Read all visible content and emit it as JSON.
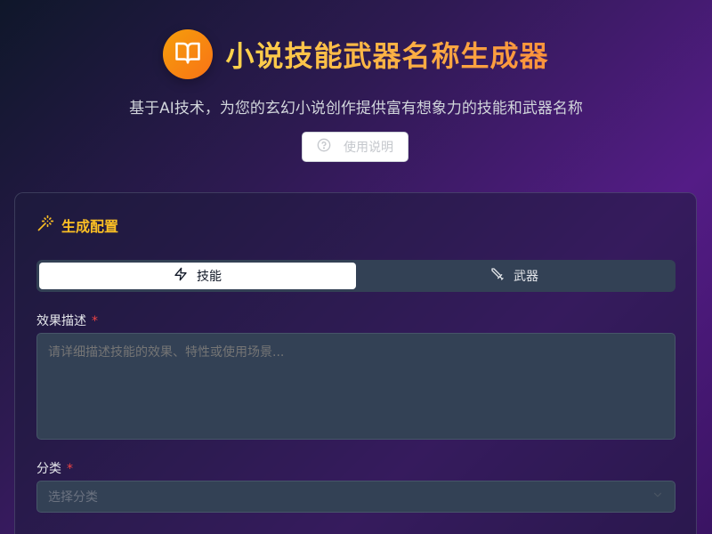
{
  "header": {
    "logo_icon": "open-book-icon",
    "title": "小说技能武器名称生成器",
    "subtitle": "基于AI技术，为您的玄幻小说创作提供富有想象力的技能和武器名称",
    "help_label": "使用说明",
    "help_icon": "question-circle-icon"
  },
  "panel": {
    "title": "生成配置",
    "title_icon": "magic-wand-icon",
    "tabs": [
      {
        "label": "技能",
        "icon": "lightning-icon",
        "active": true
      },
      {
        "label": "武器",
        "icon": "sword-icon",
        "active": false
      }
    ],
    "description": {
      "label": "效果描述",
      "required_mark": "*",
      "placeholder": "请详细描述技能的效果、特性或使用场景...",
      "value": ""
    },
    "category": {
      "label": "分类",
      "required_mark": "*",
      "placeholder": "选择分类",
      "icon": "chevron-down-icon"
    }
  },
  "colors": {
    "accent": "#fbbf24",
    "logo_gradient_start": "#f59e0b",
    "logo_gradient_end": "#f97316",
    "required": "#ef4444",
    "input_bg": "#334155"
  }
}
